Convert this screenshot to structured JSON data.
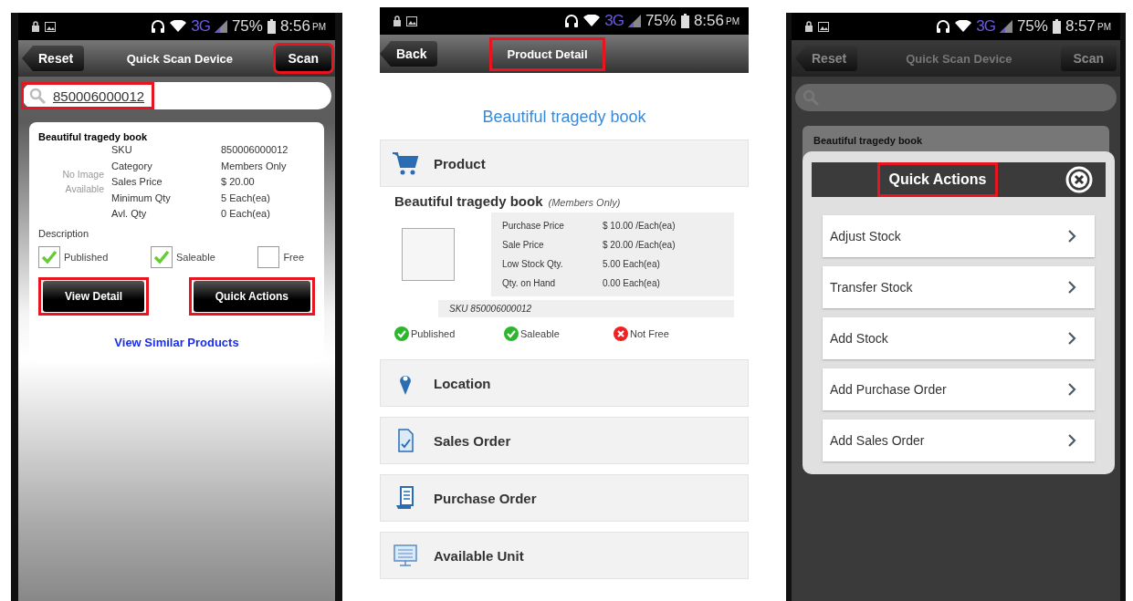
{
  "screen_1": {
    "status_bar": {
      "network": "3G",
      "battery": "75%",
      "time": "8:56",
      "ampm": "PM"
    },
    "nav": {
      "left_button": {
        "label": "Reset",
        "highlighted": false
      },
      "title": {
        "text": "Quick Scan Device",
        "highlighted": false
      },
      "right_button": {
        "label": "Scan",
        "highlighted": true
      }
    },
    "search": {
      "value": "850006000012",
      "highlighted": true
    },
    "card": {
      "title": "Beautiful tragedy book",
      "image_text": "No Image Available",
      "fields": [
        {
          "label": "SKU",
          "value": "850006000012"
        },
        {
          "label": "Category",
          "value": "Members Only"
        },
        {
          "label": "Sales Price",
          "value": "$ 20.00"
        },
        {
          "label": "Minimum Qty",
          "value": "5 Each(ea)"
        },
        {
          "label": "Avl. Qty",
          "value": "0 Each(ea)"
        }
      ],
      "description_label": "Description",
      "checkboxes": [
        {
          "label": "Published",
          "checked": true
        },
        {
          "label": "Saleable",
          "checked": true
        },
        {
          "label": "Free",
          "checked": false
        }
      ],
      "buttons": [
        {
          "label": "View Detail",
          "highlighted": true
        },
        {
          "label": "Quick Actions",
          "highlighted": true
        }
      ],
      "link": "View Similar Products"
    }
  },
  "screen_2": {
    "status_bar": {
      "network": "3G",
      "battery": "75%",
      "time": "8:56",
      "ampm": "PM"
    },
    "nav": {
      "left_button": {
        "label": "Back",
        "highlighted": false
      },
      "title": {
        "text": "Product Detail",
        "highlighted": true
      }
    },
    "product_title": "Beautiful tragedy book",
    "product_section": {
      "header": "Product",
      "name": "Beautiful tragedy book",
      "category": "(Members Only)",
      "prices": [
        {
          "label": "Purchase Price",
          "value": "$  10.00 /Each(ea)"
        },
        {
          "label": "Sale Price",
          "value": "$  20.00 /Each(ea)"
        },
        {
          "label": "Low Stock Qty.",
          "value": "5.00  Each(ea)"
        },
        {
          "label": "Qty. on Hand",
          "value": "0.00  Each(ea)"
        }
      ],
      "sku": "SKU 850006000012",
      "flags": [
        {
          "label": "Published",
          "kind": "yes"
        },
        {
          "label": "Saleable",
          "kind": "yes"
        },
        {
          "label": "Not Free",
          "kind": "no"
        }
      ]
    },
    "sections": [
      {
        "label": "Location",
        "kind": "location"
      },
      {
        "label": "Sales Order",
        "kind": "sales"
      },
      {
        "label": "Purchase Order",
        "kind": "purchase"
      },
      {
        "label": "Available Unit",
        "kind": "unit"
      }
    ]
  },
  "screen_3": {
    "status_bar": {
      "network": "3G",
      "battery": "75%",
      "time": "8:57",
      "ampm": "PM"
    },
    "nav": {
      "left_button": {
        "label": "Reset"
      },
      "title": {
        "text": "Quick Scan Device"
      },
      "right_button": {
        "label": "Scan"
      }
    },
    "card_title": "Beautiful tragedy book",
    "modal": {
      "title": "Quick Actions",
      "highlighted": true,
      "items": [
        {
          "label": "Adjust Stock"
        },
        {
          "label": "Transfer Stock"
        },
        {
          "label": "Add Stock"
        },
        {
          "label": "Add Purchase Order"
        },
        {
          "label": "Add Sales Order"
        }
      ]
    }
  }
}
